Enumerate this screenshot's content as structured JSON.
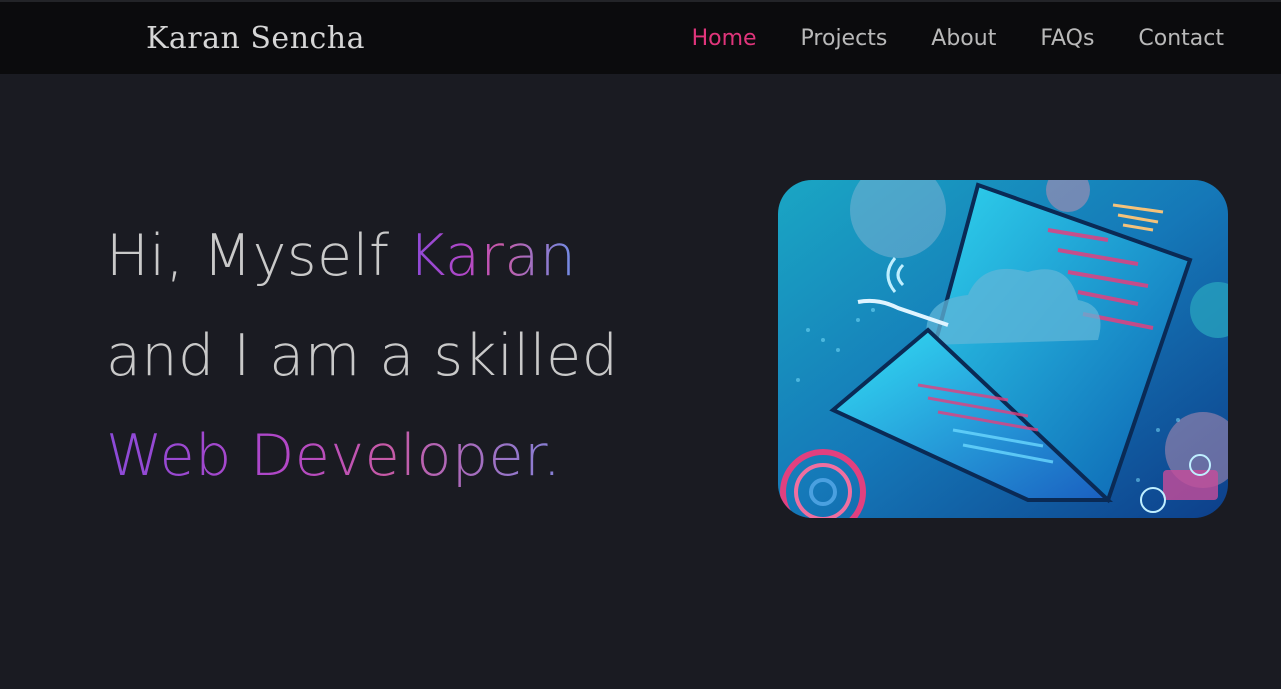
{
  "navbar": {
    "brand": "Karan Sencha",
    "links": [
      {
        "label": "Home",
        "active": true
      },
      {
        "label": "Projects",
        "active": false
      },
      {
        "label": "About",
        "active": false
      },
      {
        "label": "FAQs",
        "active": false
      },
      {
        "label": "Contact",
        "active": false
      }
    ]
  },
  "hero": {
    "line1_prefix": "Hi, Myself ",
    "line1_name": "Karan",
    "line2": "and I am a skilled",
    "line3": "Web Developer.",
    "image_icon": "laptop-cloud-illustration-icon"
  },
  "colors": {
    "background": "#1a1b22",
    "navbar": "#0b0b0d",
    "active_link": "#e0357b",
    "gradient_start": "#8b4ad8",
    "gradient_end": "#6e8ee8"
  }
}
